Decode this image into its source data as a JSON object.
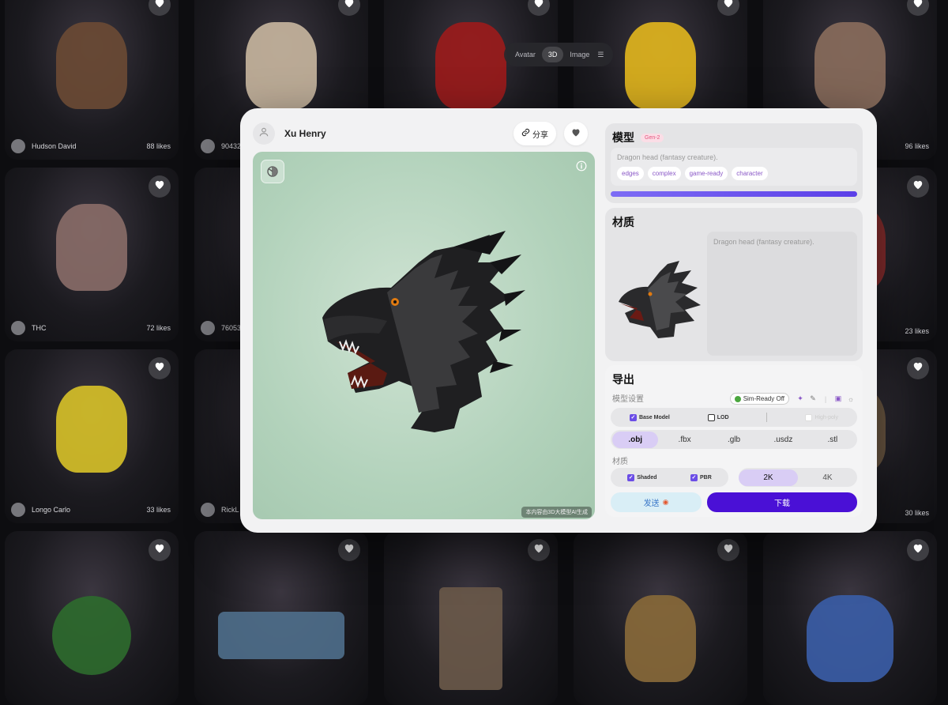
{
  "gallery": {
    "cards": [
      {
        "user": "Hudson David",
        "likes": "88 likes",
        "color": "#6b4a34"
      },
      {
        "user": "90432",
        "likes": "",
        "color": "#c9b7a0"
      },
      {
        "user": "",
        "likes": "",
        "color": "#9c1b1b"
      },
      {
        "user": "",
        "likes": "",
        "color": "#e3b71d"
      },
      {
        "user": "",
        "likes": "96 likes",
        "color": "#8a6d5c"
      },
      {
        "user": "THC",
        "likes": "72 likes",
        "color": "#8a6d68"
      },
      {
        "user": "76053",
        "likes": "",
        "color": "#3a3a3a"
      },
      {
        "user": "",
        "likes": "23 likes",
        "color": "#8c2c2c"
      },
      {
        "user": "Longo Carlo",
        "likes": "33 likes",
        "color": "#d8c228"
      },
      {
        "user": "RickL",
        "likes": "",
        "color": "#3a3a3a"
      },
      {
        "user": "",
        "likes": "30 likes",
        "color": "#6f5a42"
      },
      {
        "user": "",
        "likes": "",
        "color": "#2d6b2d"
      },
      {
        "user": "",
        "likes": "",
        "color": "#4f6f8c"
      },
      {
        "user": "",
        "likes": "",
        "color": "#6b5a4a"
      },
      {
        "user": "",
        "likes": "",
        "color": "#8a6a3a"
      },
      {
        "user": "",
        "likes": "",
        "color": "#3b5ea8"
      }
    ]
  },
  "topnav": {
    "avatar": "Avatar",
    "threeD": "3D",
    "image": "Image"
  },
  "modal": {
    "username": "Xu Henry",
    "share": "分享",
    "disclaimer": "本内容由3D大模型AI生成",
    "model": {
      "title": "模型",
      "badge": "Gen-2",
      "prompt": "Dragon head (fantasy creature).",
      "tags": [
        "edges",
        "complex",
        "game-ready",
        "character"
      ],
      "progress": 1.0
    },
    "material": {
      "title": "材质",
      "prompt": "Dragon head (fantasy creature)."
    },
    "export": {
      "title": "导出",
      "model_settings": "模型设置",
      "sim_ready": "Sim-Ready Off",
      "base_model": "Base Model",
      "lod": "LOD",
      "high_poly": "High-poly",
      "formats": [
        ".obj",
        ".fbx",
        ".glb",
        ".usdz",
        ".stl"
      ],
      "selected_format": ".obj",
      "material_label": "材质",
      "shaded": "Shaded",
      "pbr": "PBR",
      "res_2k": "2K",
      "res_4k": "4K",
      "send": "发送",
      "download": "下载"
    }
  },
  "colors": {
    "accent": "#4a10d6",
    "progress_start": "#7d6cf5",
    "progress_end": "#5b3fe8",
    "tag_text": "#8a58c7",
    "viewer_bg": "#b2d2bb"
  }
}
